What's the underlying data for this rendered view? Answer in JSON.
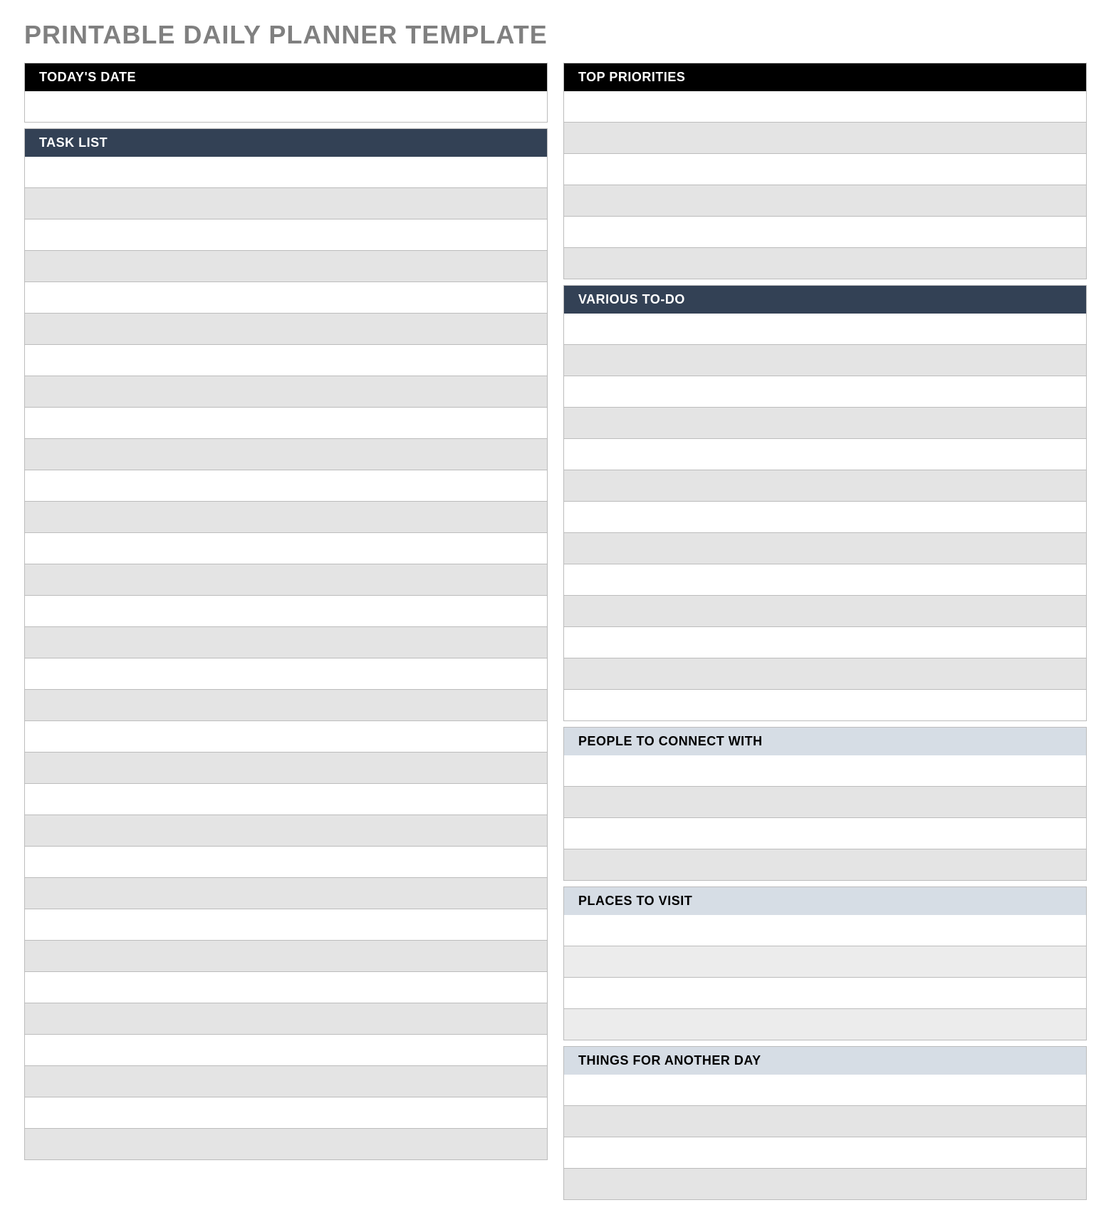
{
  "page_title": "PRINTABLE DAILY PLANNER TEMPLATE",
  "left_column": {
    "todays_date": {
      "header": "TODAY'S DATE",
      "rows": [
        ""
      ]
    },
    "task_list": {
      "header": "TASK LIST",
      "rows": [
        "",
        "",
        "",
        "",
        "",
        "",
        "",
        "",
        "",
        "",
        "",
        "",
        "",
        "",
        "",
        "",
        "",
        "",
        "",
        "",
        "",
        "",
        "",
        "",
        "",
        "",
        "",
        "",
        "",
        "",
        "",
        ""
      ]
    }
  },
  "right_column": {
    "top_priorities": {
      "header": "TOP PRIORITIES",
      "rows": [
        "",
        "",
        "",
        "",
        "",
        ""
      ]
    },
    "various_todo": {
      "header": "VARIOUS TO-DO",
      "rows": [
        "",
        "",
        "",
        "",
        "",
        "",
        "",
        "",
        "",
        "",
        "",
        "",
        ""
      ]
    },
    "people_to_connect": {
      "header": "PEOPLE TO CONNECT WITH",
      "rows": [
        "",
        "",
        "",
        ""
      ]
    },
    "places_to_visit": {
      "header": "PLACES TO VISIT",
      "rows": [
        "",
        "",
        "",
        ""
      ]
    },
    "things_for_another_day": {
      "header": "THINGS FOR ANOTHER DAY",
      "rows": [
        "",
        "",
        "",
        ""
      ]
    }
  }
}
